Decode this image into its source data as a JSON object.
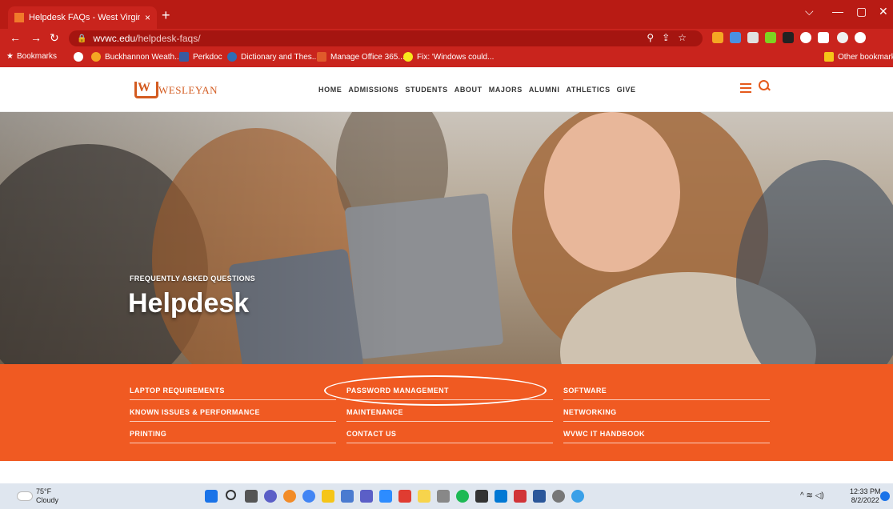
{
  "browser": {
    "tab_title": "Helpdesk FAQs - West Virginia W",
    "tab_close": "×",
    "new_tab": "+",
    "url_host": "wvwc.edu",
    "url_path": "/helpdesk-faqs/",
    "bookmarks": [
      "Bookmarks",
      "Buckhannon Weath...",
      "Perkdoc",
      "Dictionary and Thes...",
      "Manage Office 365...",
      "Fix: 'Windows could..."
    ],
    "other_bookmarks": "Other bookmarks",
    "colors": {
      "chrome": "#c9241d",
      "tabbar": "#b81b14"
    }
  },
  "site": {
    "logo_text": "WESLEYAN",
    "nav": [
      "HOME",
      "ADMISSIONS",
      "STUDENTS",
      "ABOUT",
      "MAJORS",
      "ALUMNI",
      "ATHLETICS",
      "GIVE"
    ],
    "accent": "#f05a22",
    "hero": {
      "subtitle": "FREQUENTLY ASKED QUESTIONS",
      "title": "Helpdesk"
    },
    "faq_links": {
      "col1": [
        "LAPTOP REQUIREMENTS",
        "KNOWN ISSUES & PERFORMANCE",
        "PRINTING"
      ],
      "col2": [
        "PASSWORD MANAGEMENT",
        "MAINTENANCE",
        "CONTACT US"
      ],
      "col3": [
        "SOFTWARE",
        "NETWORKING",
        "WVWC IT HANDBOOK"
      ]
    }
  },
  "taskbar": {
    "temp": "75°F",
    "condition": "Cloudy",
    "time": "12:33 PM",
    "date": "8/2/2022"
  }
}
